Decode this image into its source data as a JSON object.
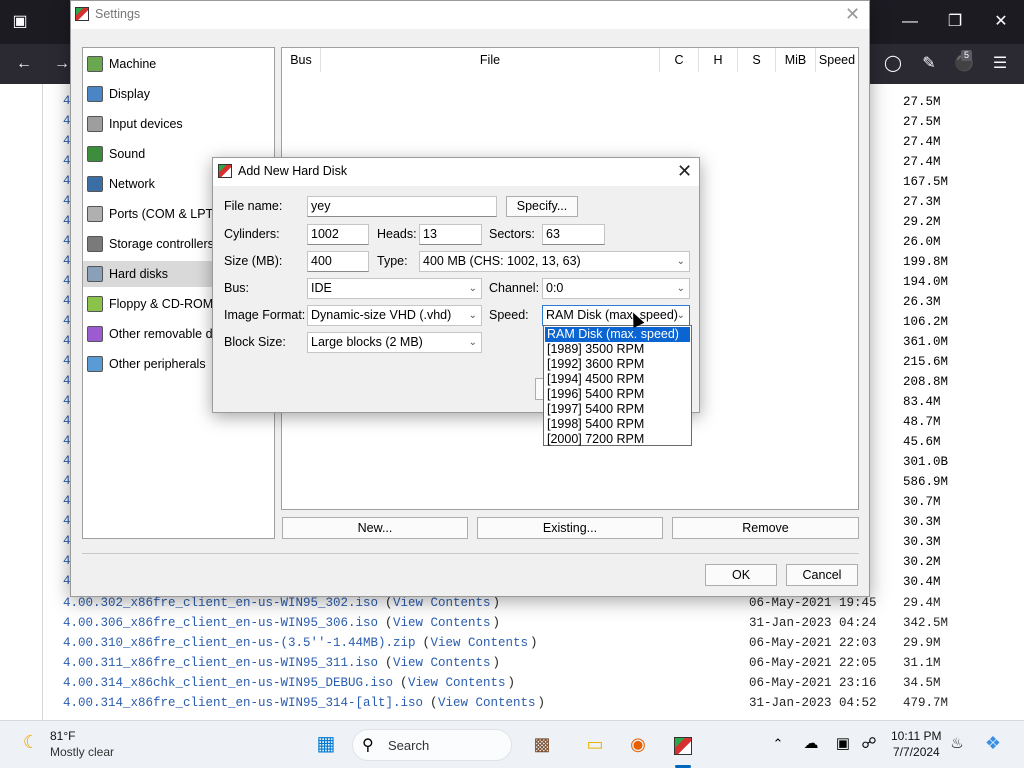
{
  "browser": {
    "ublock_count": "5",
    "icons": {
      "tab_overview": "tab-overview-icon",
      "back": "back-arrow-icon",
      "forward": "forward-arrow-icon",
      "account": "account-icon",
      "extensions": "extensions-icon",
      "ublock": "ublock-shield-icon",
      "menu": "hamburger-menu-icon"
    }
  },
  "listing": {
    "left_prefix": "4.",
    "side_sizes": [
      "27.5M",
      "27.5M",
      "27.4M",
      "27.4M",
      "167.5M",
      "27.3M",
      "29.2M",
      "26.0M",
      "199.8M",
      "194.0M",
      "26.3M",
      "106.2M",
      "361.0M",
      "215.6M",
      "208.8M",
      "83.4M",
      "48.7M",
      "45.6M",
      "301.0B",
      "586.9M",
      "30.7M",
      "30.3M",
      "30.3M",
      "30.2M",
      "30.4M"
    ],
    "rows": [
      {
        "name": "4.00.302_x86fre_client_en-us-WIN95_302.iso",
        "view": "View Contents",
        "date": "06-May-2021 19:45",
        "size": "29.4M"
      },
      {
        "name": "4.00.306_x86fre_client_en-us-WIN95_306.iso",
        "view": "View Contents",
        "date": "31-Jan-2023 04:24",
        "size": "342.5M"
      },
      {
        "name": "4.00.310_x86fre_client_en-us-(3.5''-1.44MB).zip",
        "view": "View Contents",
        "date": "06-May-2021 22:03",
        "size": "29.9M"
      },
      {
        "name": "4.00.311_x86fre_client_en-us-WIN95_311.iso",
        "view": "View Contents",
        "date": "06-May-2021 22:05",
        "size": "31.1M"
      },
      {
        "name": "4.00.314_x86chk_client_en-us-WIN95_DEBUG.iso",
        "view": "View Contents",
        "date": "06-May-2021 23:16",
        "size": "34.5M"
      },
      {
        "name": "4.00.314_x86fre_client_en-us-WIN95_314-[alt].iso",
        "view": "View Contents",
        "date": "31-Jan-2023 04:52",
        "size": "479.7M"
      }
    ]
  },
  "settings": {
    "title": "Settings",
    "nav": [
      {
        "label": "Machine",
        "icon": "machine-icon",
        "color": "#6aa84f"
      },
      {
        "label": "Display",
        "icon": "display-icon",
        "color": "#4a86c5"
      },
      {
        "label": "Input devices",
        "icon": "input-devices-icon",
        "color": "#9e9e9e"
      },
      {
        "label": "Sound",
        "icon": "sound-icon",
        "color": "#3c8d3c"
      },
      {
        "label": "Network",
        "icon": "network-icon",
        "color": "#3a6ea5"
      },
      {
        "label": "Ports (COM & LPT)",
        "icon": "ports-icon",
        "color": "#b0b0b0"
      },
      {
        "label": "Storage controllers",
        "icon": "storage-controllers-icon",
        "color": "#7a7a7a"
      },
      {
        "label": "Hard disks",
        "icon": "hard-disk-icon",
        "color": "#8aa0b8"
      },
      {
        "label": "Floppy & CD-ROM drives",
        "icon": "floppy-cdrom-icon",
        "color": "#8bc34a"
      },
      {
        "label": "Other removable devices",
        "icon": "removable-devices-icon",
        "color": "#9c5bd0"
      },
      {
        "label": "Other peripherals",
        "icon": "peripherals-icon",
        "color": "#5b9bd5"
      }
    ],
    "selected_nav": "Hard disks",
    "table_headers": [
      "Bus",
      "File",
      "C",
      "H",
      "S",
      "MiB",
      "Speed"
    ],
    "buttons": {
      "new": "New...",
      "existing": "Existing...",
      "remove": "Remove",
      "ok": "OK",
      "cancel": "Cancel"
    }
  },
  "dialog": {
    "title": "Add New Hard Disk",
    "file_name_label": "File name:",
    "file_name": "yey",
    "specify_button": "Specify...",
    "cylinders_label": "Cylinders:",
    "cylinders": "1002",
    "heads_label": "Heads:",
    "heads": "13",
    "sectors_label": "Sectors:",
    "sectors": "63",
    "size_label": "Size (MB):",
    "size": "400",
    "type_label": "Type:",
    "type": "400 MB (CHS: 1002, 13, 63)",
    "bus_label": "Bus:",
    "bus": "IDE",
    "channel_label": "Channel:",
    "channel": "0:0",
    "image_format_label": "Image Format:",
    "image_format": "Dynamic-size VHD (.vhd)",
    "speed_label": "Speed:",
    "speed": "RAM Disk (max. speed)",
    "block_size_label": "Block Size:",
    "block_size": "Large blocks (2 MB)",
    "speed_options": [
      "RAM Disk (max. speed)",
      "[1989] 3500 RPM",
      "[1992] 3600 RPM",
      "[1994] 4500 RPM",
      "[1996] 5400 RPM",
      "[1997] 5400 RPM",
      "[1998] 5400 RPM",
      "[2000] 7200 RPM"
    ]
  },
  "taskbar": {
    "temperature": "81°F",
    "weather": "Mostly clear",
    "search": "Search",
    "time": "10:11 PM",
    "date": "7/7/2024"
  }
}
